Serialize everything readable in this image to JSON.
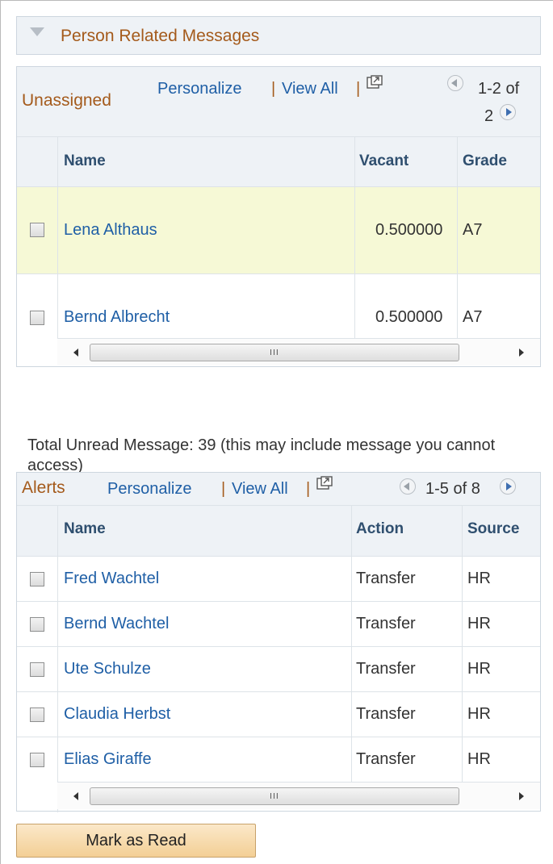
{
  "section": {
    "title": "Person Related Messages"
  },
  "unassigned": {
    "title": "Unassigned",
    "personalize": "Personalize",
    "view_all": "View All",
    "separator": "|",
    "pager_line1": "1-2 of",
    "pager_line2": "2",
    "columns": [
      "Name",
      "Vacant",
      "Grade"
    ],
    "rows": [
      {
        "name": "Lena Althaus",
        "vacant": "0.500000",
        "grade": "A7"
      },
      {
        "name": "Bernd Albrecht",
        "vacant": "0.500000",
        "grade": "A7"
      }
    ],
    "scroll_grip": "III"
  },
  "note": "Total Unread Message: 39 (this may include message you cannot access)",
  "alerts": {
    "title": "Alerts",
    "personalize": "Personalize",
    "view_all": "View All",
    "separator": "|",
    "pager": "1-5 of 8",
    "columns": [
      "Name",
      "Action",
      "Source"
    ],
    "rows": [
      {
        "name": "Fred Wachtel",
        "action": "Transfer",
        "source": "HR"
      },
      {
        "name": "Bernd Wachtel",
        "action": "Transfer",
        "source": "HR"
      },
      {
        "name": "Ute Schulze",
        "action": "Transfer",
        "source": "HR"
      },
      {
        "name": "Claudia Herbst",
        "action": "Transfer",
        "source": "HR"
      },
      {
        "name": "Elias Giraffe",
        "action": "Transfer",
        "source": "HR"
      }
    ],
    "scroll_grip": "III"
  },
  "mark_read_button": "Mark as Read",
  "colors": {
    "link": "#1f5fa6",
    "title": "#a45a1b",
    "highlight_row": "#f6f9d6",
    "button": "#f3cf95"
  }
}
